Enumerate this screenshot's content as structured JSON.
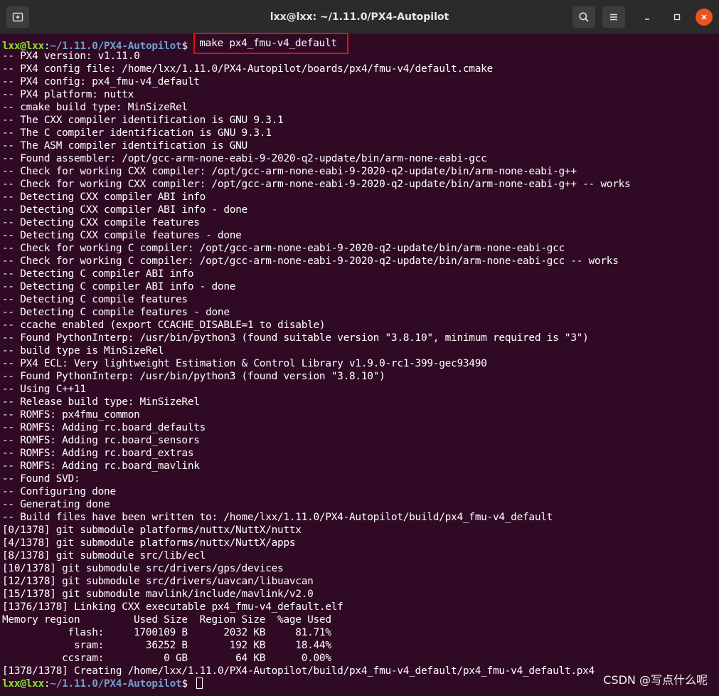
{
  "window": {
    "title": "lxx@lxx: ~/1.11.0/PX4-Autopilot"
  },
  "titlebar": {
    "new_tab_icon": "new-tab-icon",
    "search_icon": "search-icon",
    "menu_icon": "hamburger-menu-icon",
    "minimize_icon": "minimize-icon",
    "maximize_icon": "maximize-icon",
    "close_icon": "close-icon",
    "close_color": "#e95420"
  },
  "prompt": {
    "user": "lxx@lxx",
    "path": "~/1.11.0/PX4-Autopilot",
    "symbol": "$ "
  },
  "command": "make px4_fmu-v4_default",
  "output": [
    "-- PX4 version: v1.11.0",
    "-- PX4 config file: /home/lxx/1.11.0/PX4-Autopilot/boards/px4/fmu-v4/default.cmake",
    "-- PX4 config: px4_fmu-v4_default",
    "-- PX4 platform: nuttx",
    "-- cmake build type: MinSizeRel",
    "-- The CXX compiler identification is GNU 9.3.1",
    "-- The C compiler identification is GNU 9.3.1",
    "-- The ASM compiler identification is GNU",
    "-- Found assembler: /opt/gcc-arm-none-eabi-9-2020-q2-update/bin/arm-none-eabi-gcc",
    "-- Check for working CXX compiler: /opt/gcc-arm-none-eabi-9-2020-q2-update/bin/arm-none-eabi-g++",
    "-- Check for working CXX compiler: /opt/gcc-arm-none-eabi-9-2020-q2-update/bin/arm-none-eabi-g++ -- works",
    "-- Detecting CXX compiler ABI info",
    "-- Detecting CXX compiler ABI info - done",
    "-- Detecting CXX compile features",
    "-- Detecting CXX compile features - done",
    "-- Check for working C compiler: /opt/gcc-arm-none-eabi-9-2020-q2-update/bin/arm-none-eabi-gcc",
    "-- Check for working C compiler: /opt/gcc-arm-none-eabi-9-2020-q2-update/bin/arm-none-eabi-gcc -- works",
    "-- Detecting C compiler ABI info",
    "-- Detecting C compiler ABI info - done",
    "-- Detecting C compile features",
    "-- Detecting C compile features - done",
    "-- ccache enabled (export CCACHE_DISABLE=1 to disable)",
    "-- Found PythonInterp: /usr/bin/python3 (found suitable version \"3.8.10\", minimum required is \"3\")",
    "-- build type is MinSizeRel",
    "-- PX4 ECL: Very lightweight Estimation & Control Library v1.9.0-rc1-399-gec93490",
    "-- Found PythonInterp: /usr/bin/python3 (found version \"3.8.10\")",
    "-- Using C++11",
    "-- Release build type: MinSizeRel",
    "-- ROMFS: px4fmu_common",
    "-- ROMFS: Adding rc.board_defaults",
    "-- ROMFS: Adding rc.board_sensors",
    "-- ROMFS: Adding rc.board_extras",
    "-- ROMFS: Adding rc.board_mavlink",
    "-- Found SVD:",
    "-- Configuring done",
    "-- Generating done",
    "-- Build files have been written to: /home/lxx/1.11.0/PX4-Autopilot/build/px4_fmu-v4_default",
    "[0/1378] git submodule platforms/nuttx/NuttX/nuttx",
    "[4/1378] git submodule platforms/nuttx/NuttX/apps",
    "[8/1378] git submodule src/lib/ecl",
    "[10/1378] git submodule src/drivers/gps/devices",
    "[12/1378] git submodule src/drivers/uavcan/libuavcan",
    "[15/1378] git submodule mavlink/include/mavlink/v2.0",
    "[1376/1378] Linking CXX executable px4_fmu-v4_default.elf",
    "Memory region         Used Size  Region Size  %age Used",
    "           flash:     1700109 B      2032 KB     81.71%",
    "            sram:       36252 B       192 KB     18.44%",
    "          ccsram:          0 GB        64 KB      0.00%",
    "[1378/1378] Creating /home/lxx/1.11.0/PX4-Autopilot/build/px4_fmu-v4_default/px4_fmu-v4_default.px4"
  ],
  "watermark": "CSDN @写点什么呢"
}
